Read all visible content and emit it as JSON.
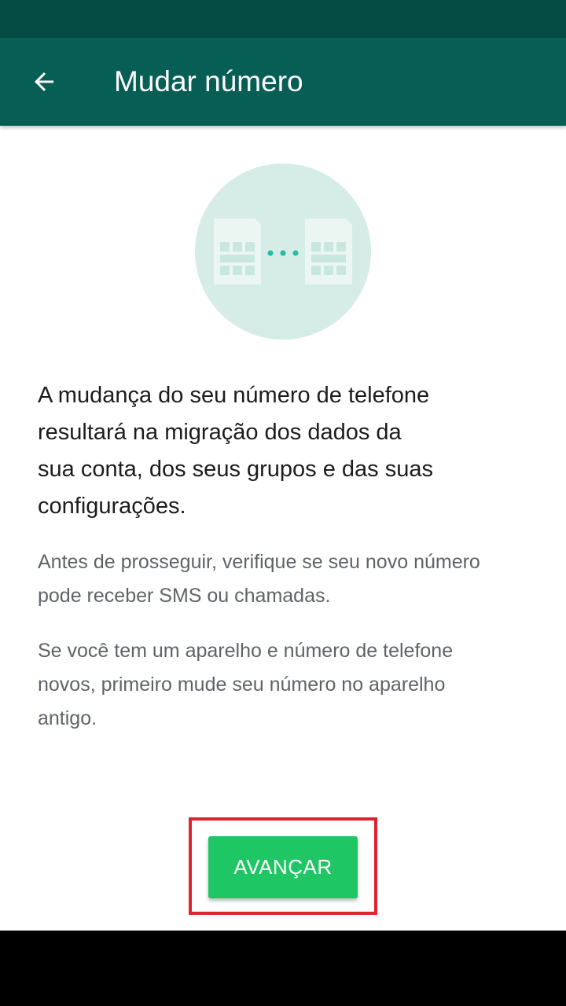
{
  "app_bar": {
    "title": "Mudar número",
    "back_icon": "arrow-back-icon"
  },
  "illustration": {
    "icon": "sim-card-transfer-icon",
    "circle_color": "#d6ede7",
    "card_color": "#ebf5f2",
    "chip_color": "#c8e7df",
    "dots_color": "#1ebea5"
  },
  "main": {
    "headline": "A mudança do seu número de telefone\nresultará na migração dos dados da\nsua conta, dos seus grupos e das suas\nconfigurações.",
    "paragraph_1": "Antes de prosseguir, verifique se seu novo número\npode receber SMS ou chamadas.",
    "paragraph_2": "Se você tem um aparelho e número de telefone\nnovos, primeiro mude seu número no aparelho\nantigo."
  },
  "actions": {
    "next_label": "AVANÇAR"
  },
  "colors": {
    "status_bar": "#054d44",
    "app_bar": "#075e54",
    "button": "#1ec764",
    "highlight": "#e0212e"
  }
}
